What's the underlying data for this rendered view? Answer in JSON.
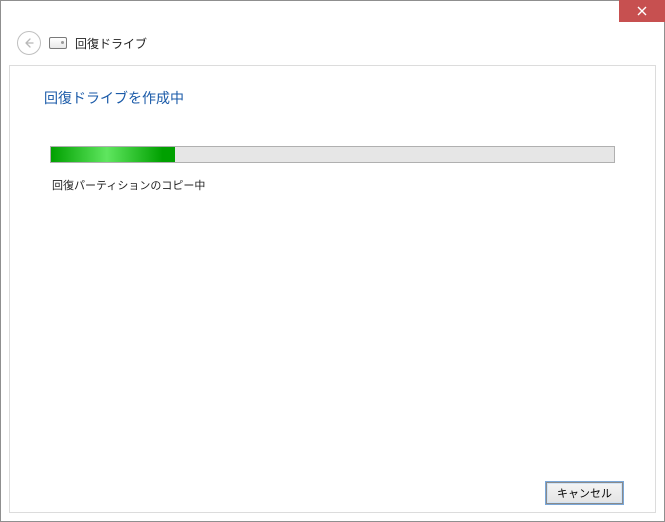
{
  "window": {
    "title": "回復ドライブ"
  },
  "page": {
    "heading": "回復ドライブを作成中",
    "status": "回復パーティションのコピー中",
    "progress_percent": 22
  },
  "footer": {
    "cancel_label": "キャンセル"
  },
  "colors": {
    "accent": "#1a5aa8",
    "close_bg": "#c75050",
    "progress_fill": "#00a000"
  }
}
